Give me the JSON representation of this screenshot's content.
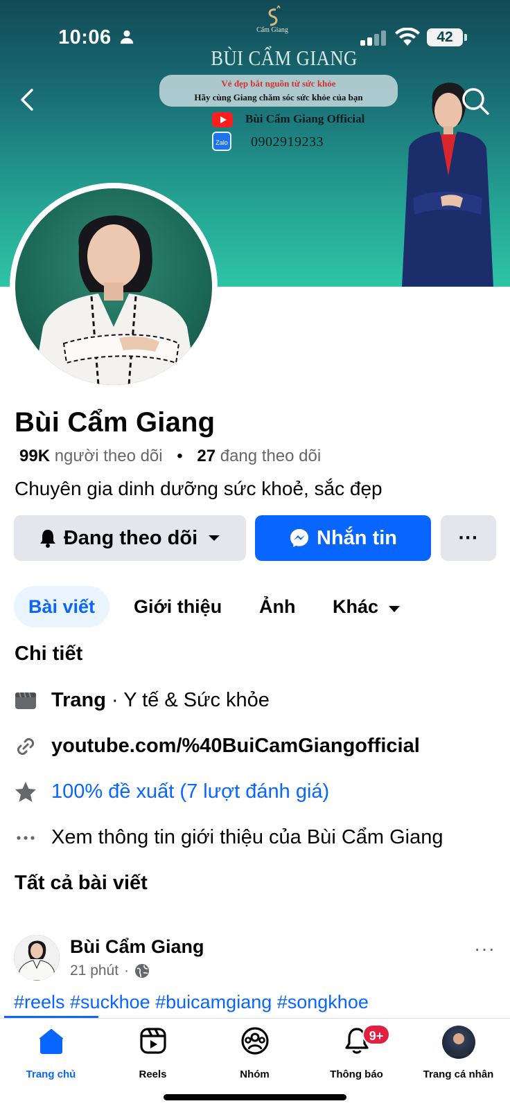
{
  "status_bar": {
    "time": "10:06",
    "battery": "42"
  },
  "cover": {
    "logo_text": "Cẩm Giang",
    "title": "BÙI CẨM GIANG",
    "slogan_line1": "Vẻ đẹp bắt nguồn từ sức khỏe",
    "slogan_line2": "Hãy cùng Giang chăm sóc sức khỏe của bạn",
    "youtube_label": "Bùi Cẩm Giang Official",
    "zalo_icon_text": "Zalo",
    "phone": "0902919233"
  },
  "profile": {
    "name": "Bùi Cẩm Giang",
    "followers_count": "99K",
    "followers_label": "người theo dõi",
    "following_count": "27",
    "following_label": "đang theo dõi",
    "bio": "Chuyên gia dinh dưỡng sức khoẻ, sắc đẹp"
  },
  "actions": {
    "follow_label": "Đang theo dõi",
    "message_label": "Nhắn tin",
    "more_label": "···"
  },
  "tabs": {
    "posts": "Bài viết",
    "intro": "Giới thiệu",
    "photos": "Ảnh",
    "more": "Khác"
  },
  "details": {
    "title": "Chi tiết",
    "page_type_bold": "Trang",
    "page_type_rest": " · Y tế & Sức khỏe",
    "website": "youtube.com/%40BuiCamGiangofficial",
    "rating": "100% đề xuất (7 lượt đánh giá)",
    "see_intro": "Xem thông tin giới thiệu của Bùi Cẩm Giang"
  },
  "posts_section": {
    "title": "Tất cả bài viết",
    "author": "Bùi Cẩm Giang",
    "time": "21 phút",
    "more": "···",
    "tags": "#reels #suckhoe #buicamgiang #songkhoe"
  },
  "bottom_nav": {
    "home": "Trang chủ",
    "reels": "Reels",
    "groups": "Nhóm",
    "notifications": "Thông báo",
    "notifications_badge": "9+",
    "profile": "Trang cá nhân"
  },
  "colors": {
    "accent": "#0866ff",
    "badge": "#e41e3f",
    "cover_top": "#114a56",
    "cover_bottom": "#2ec4a6"
  }
}
